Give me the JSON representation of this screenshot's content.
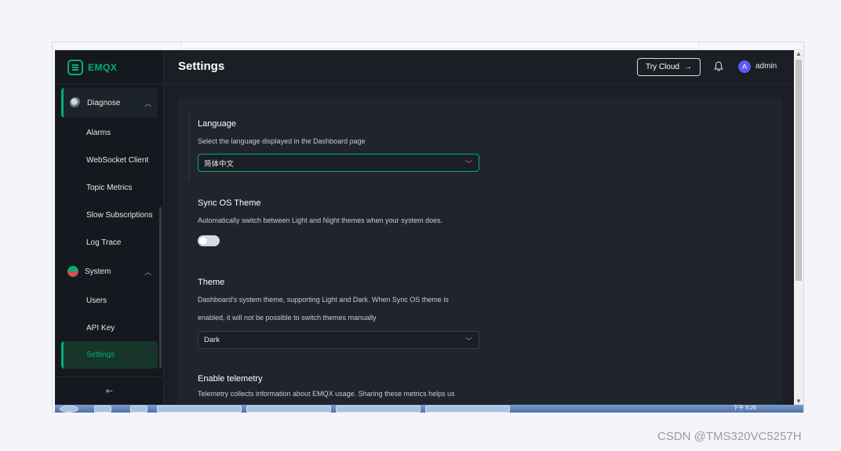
{
  "app": {
    "brand": "EMQX",
    "accent": "#00b173"
  },
  "sidebar": {
    "groups": [
      {
        "label": "Diagnose",
        "icon": "diagnose-icon"
      },
      {
        "label": "System",
        "icon": "system-icon"
      }
    ],
    "diagnose_items": [
      "Alarms",
      "WebSocket Client",
      "Topic Metrics",
      "Slow Subscriptions",
      "Log Trace"
    ],
    "system_items": [
      "Users",
      "API Key",
      "Settings"
    ],
    "active_item": "Settings",
    "collapse_icon": "collapse-sidebar-icon"
  },
  "header": {
    "title": "Settings",
    "try_cloud_label": "Try Cloud",
    "username": "admin",
    "avatar_letter": "A"
  },
  "settings": {
    "language": {
      "title": "Language",
      "description": "Select the language displayed in the Dashboard page",
      "value": "简体中文"
    },
    "sync_os_theme": {
      "title": "Sync OS Theme",
      "description": "Automatically switch between Light and Night themes when your system does.",
      "enabled": false
    },
    "theme": {
      "title": "Theme",
      "description_line1": "Dashboard's system theme, supporting Light and Dark. When Sync OS theme is",
      "description_line2": "enabled, it will not be possible to switch themes manually",
      "value": "Dark"
    },
    "telemetry": {
      "title": "Enable telemetry",
      "description": "Telemetry collects information about EMQX usage. Sharing these metrics helps us"
    }
  },
  "taskbar": {
    "clock": "下午 5:26"
  },
  "watermark": "CSDN @TMS320VC5257H"
}
